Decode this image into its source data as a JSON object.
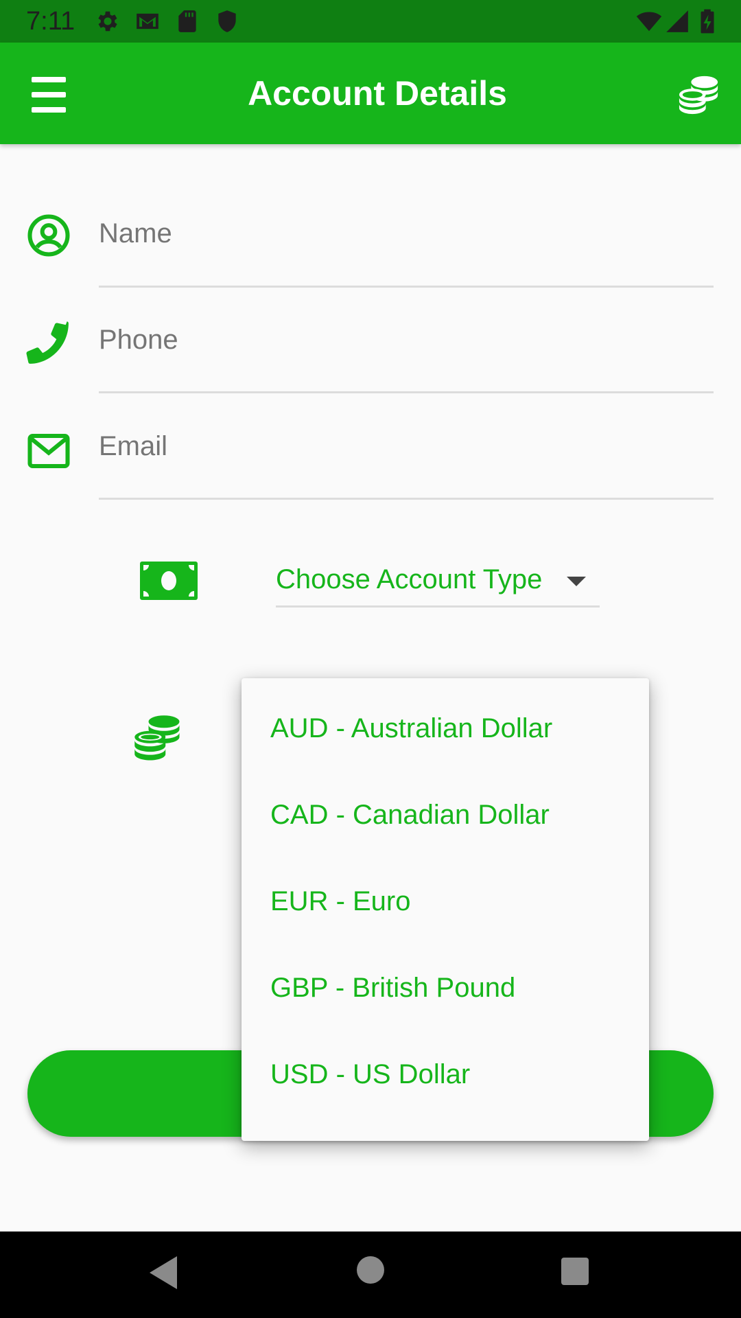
{
  "status_bar": {
    "time": "7:11",
    "left_icons": [
      "settings-icon",
      "gmail-icon",
      "sd-card-icon",
      "shield-icon"
    ],
    "right_icons": [
      "wifi-icon",
      "cell-signal-icon",
      "battery-charging-icon"
    ]
  },
  "app_bar": {
    "title": "Account Details",
    "left_icon": "menu-icon",
    "right_icon": "coins-icon"
  },
  "form": {
    "name": {
      "placeholder": "Name",
      "value": "",
      "icon": "account-circle-icon"
    },
    "phone": {
      "placeholder": "Phone",
      "value": "",
      "icon": "phone-icon"
    },
    "email": {
      "placeholder": "Email",
      "value": "",
      "icon": "envelope-icon"
    },
    "account_type": {
      "label": "Choose Account Type",
      "icon": "cash-icon"
    },
    "currency": {
      "icon": "coins-icon"
    }
  },
  "currency_menu": {
    "items": [
      "AUD - Australian Dollar",
      "CAD - Canadian Dollar",
      "EUR - Euro",
      "GBP - British Pound",
      "USD - US Dollar"
    ]
  },
  "colors": {
    "primary": "#16b51b",
    "status_bar": "#0f7f12",
    "background": "#fafafa",
    "nav_bar": "#000000"
  },
  "nav_bar": {
    "icons": [
      "back-icon",
      "home-icon",
      "recents-icon"
    ]
  }
}
